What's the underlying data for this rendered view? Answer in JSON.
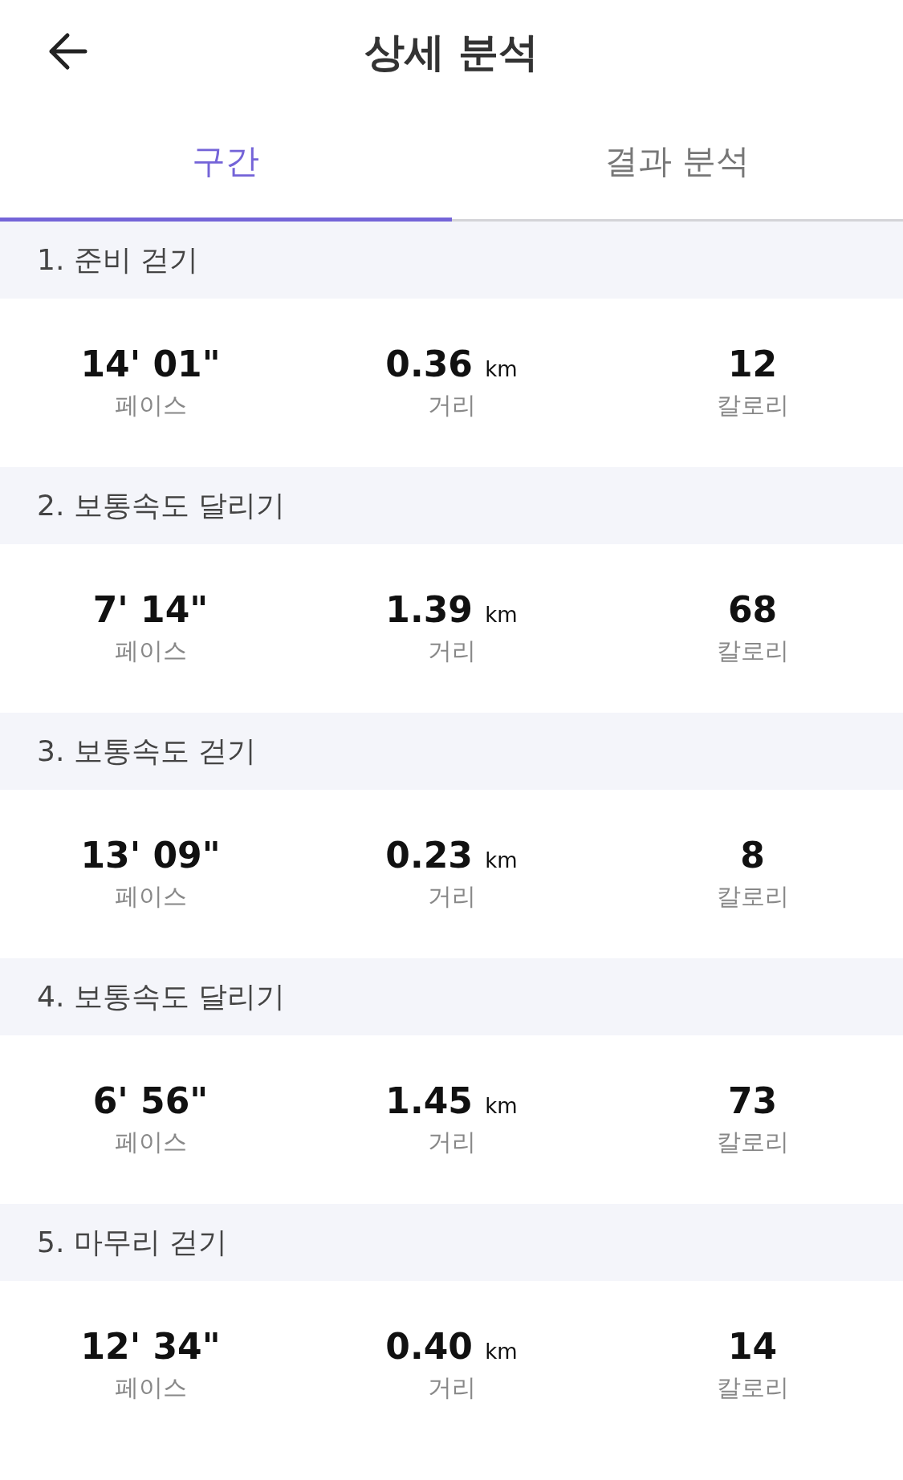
{
  "header": {
    "title": "상세 분석"
  },
  "tabs": [
    {
      "label": "구간",
      "selected": true
    },
    {
      "label": "결과 분석",
      "selected": false
    }
  ],
  "segments": [
    {
      "title": "1. 준비 걷기",
      "pace": "14' 01\"",
      "pace_label": "페이스",
      "distance": "0.36",
      "distance_unit": "km",
      "distance_label": "거리",
      "calories": "12",
      "calories_label": "칼로리"
    },
    {
      "title": "2. 보통속도 달리기",
      "pace": "7' 14\"",
      "pace_label": "페이스",
      "distance": "1.39",
      "distance_unit": "km",
      "distance_label": "거리",
      "calories": "68",
      "calories_label": "칼로리"
    },
    {
      "title": "3. 보통속도 걷기",
      "pace": "13' 09\"",
      "pace_label": "페이스",
      "distance": "0.23",
      "distance_unit": "km",
      "distance_label": "거리",
      "calories": "8",
      "calories_label": "칼로리"
    },
    {
      "title": "4. 보통속도 달리기",
      "pace": "6' 56\"",
      "pace_label": "페이스",
      "distance": "1.45",
      "distance_unit": "km",
      "distance_label": "거리",
      "calories": "73",
      "calories_label": "칼로리"
    },
    {
      "title": "5. 마무리 걷기",
      "pace": "12' 34\"",
      "pace_label": "페이스",
      "distance": "0.40",
      "distance_unit": "km",
      "distance_label": "거리",
      "calories": "14",
      "calories_label": "칼로리"
    }
  ]
}
